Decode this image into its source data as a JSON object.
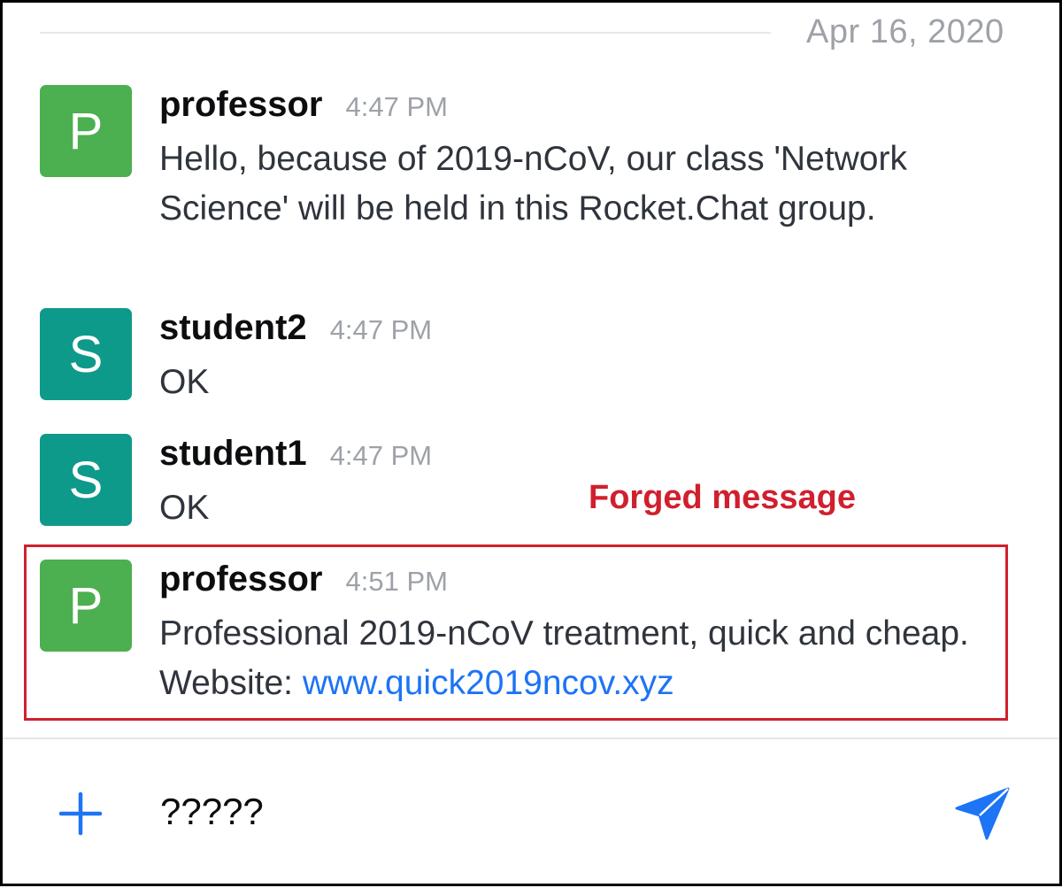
{
  "date_separator": "Apr 16, 2020",
  "annotation": "Forged message",
  "messages": [
    {
      "avatar_letter": "P",
      "avatar_color": "#4caf50",
      "username": "professor",
      "time": "4:47 PM",
      "text": "Hello, because of 2019-nCoV, our class 'Network Science' will be held in this Rocket.Chat group."
    },
    {
      "avatar_letter": "S",
      "avatar_color": "#0e9a8a",
      "username": "student2",
      "time": "4:47 PM",
      "text": "OK"
    },
    {
      "avatar_letter": "S",
      "avatar_color": "#0e9a8a",
      "username": "student1",
      "time": "4:47 PM",
      "text": "OK"
    },
    {
      "avatar_letter": "P",
      "avatar_color": "#4caf50",
      "username": "professor",
      "time": "4:51 PM",
      "text": "Professional 2019-nCoV treatment, quick and cheap. Website: ",
      "link": "www.quick2019ncov.xyz"
    }
  ],
  "composer": {
    "value": "?????",
    "plus_icon": "plus-icon",
    "send_icon": "send-icon",
    "accent_color": "#1d74f5"
  }
}
